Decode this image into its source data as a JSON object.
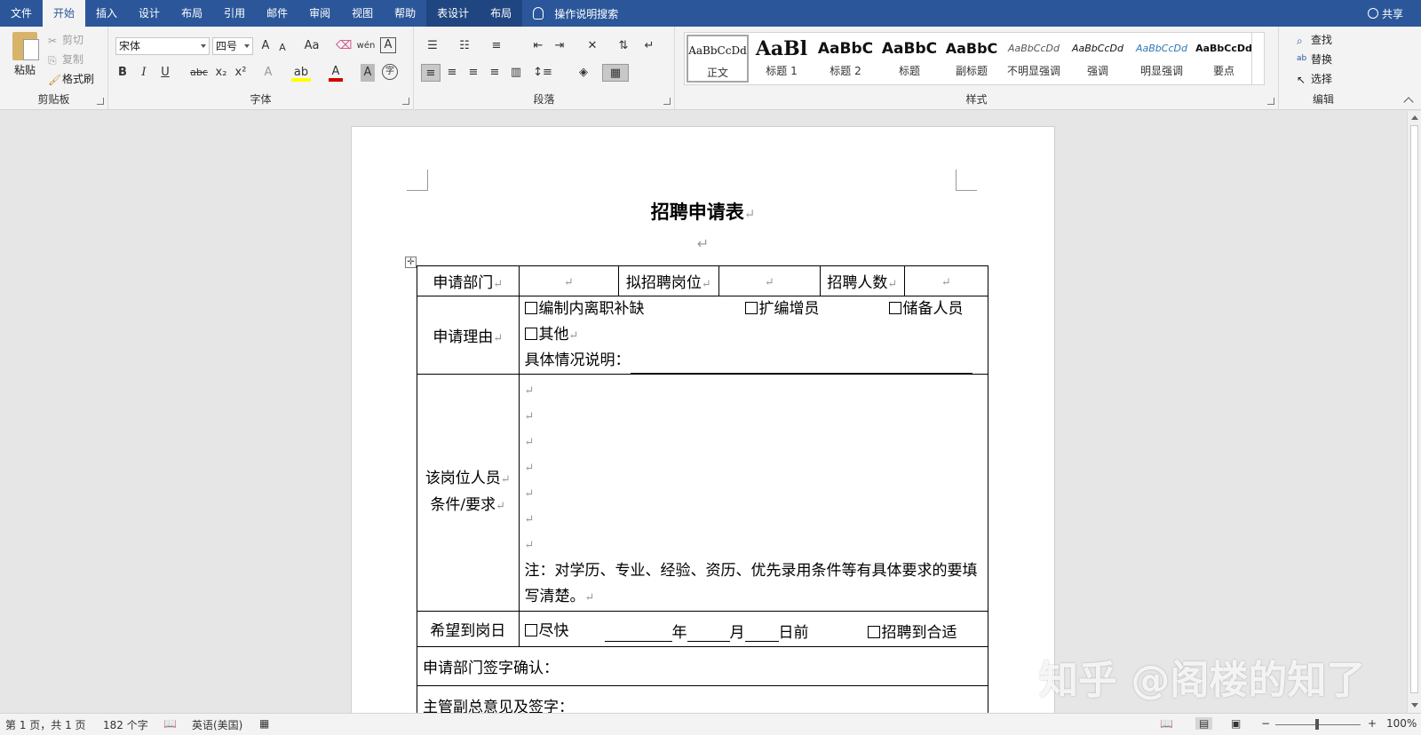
{
  "tabs": [
    {
      "label": "文件"
    },
    {
      "label": "开始"
    },
    {
      "label": "插入"
    },
    {
      "label": "设计"
    },
    {
      "label": "布局"
    },
    {
      "label": "引用"
    },
    {
      "label": "邮件"
    },
    {
      "label": "审阅"
    },
    {
      "label": "视图"
    },
    {
      "label": "帮助"
    },
    {
      "label": "表设计"
    },
    {
      "label": "布局"
    }
  ],
  "tellme": "操作说明搜索",
  "share": "共享",
  "ribbon": {
    "clipboard": {
      "paste": "粘贴",
      "cut": "剪切",
      "copy": "复制",
      "format_painter": "格式刷",
      "label": "剪贴板"
    },
    "font": {
      "name": "宋体",
      "size": "四号",
      "label": "字体",
      "bold": "B",
      "italic": "I",
      "underline": "U",
      "strike": "abc",
      "sub": "x₂",
      "sup": "x²",
      "case": "Aa",
      "grow": "A",
      "shrink": "A",
      "phonetic": "wén",
      "border_char": "A",
      "char_shade": "A",
      "enclose": "字"
    },
    "paragraph": {
      "label": "段落"
    },
    "styles": {
      "label": "样式",
      "items": [
        {
          "preview": "AaBbCcDd",
          "name": "正文"
        },
        {
          "preview": "AaBl",
          "name": "标题 1"
        },
        {
          "preview": "AaBbC",
          "name": "标题 2"
        },
        {
          "preview": "AaBbC",
          "name": "标题"
        },
        {
          "preview": "AaBbC",
          "name": "副标题"
        },
        {
          "preview": "AaBbCcDd",
          "name": "不明显强调"
        },
        {
          "preview": "AaBbCcDd",
          "name": "强调"
        },
        {
          "preview": "AaBbCcDd",
          "name": "明显强调"
        },
        {
          "preview": "AaBbCcDd",
          "name": "要点"
        }
      ]
    },
    "editing": {
      "find": "查找",
      "replace": "替换",
      "select": "选择",
      "label": "编辑"
    }
  },
  "document": {
    "title": "招聘申请表",
    "table": {
      "dept_label": "申请部门",
      "position_label": "拟招聘岗位",
      "count_label": "招聘人数",
      "reason_label": "申请理由",
      "reason_opt1": "编制内离职补缺",
      "reason_opt2": "扩编增员",
      "reason_opt3": "储备人员",
      "reason_opt4": "其他",
      "reason_detail": "具体情况说明：",
      "req_label_1": "该岗位人员",
      "req_label_2": "条件/要求",
      "req_note": "注：对学历、专业、经验、资历、优先录用条件等有具体要求的要填写清楚。",
      "date_label": "希望到岗日",
      "date_opt1": "尽快",
      "date_year": "年",
      "date_month": "月",
      "date_day": "日前",
      "date_opt2": "招聘到合适",
      "dept_sign": "申请部门签字确认：",
      "supervisor_sign": "主管副总意见及签字："
    }
  },
  "watermark": "知乎 @阁楼的知了",
  "status": {
    "page": "第 1 页，共 1 页",
    "words": "182 个字",
    "language": "英语(美国)",
    "zoom": "100%"
  },
  "colors": {
    "accent": "#2b579a",
    "ribbon_bg": "#f3f3f3"
  }
}
